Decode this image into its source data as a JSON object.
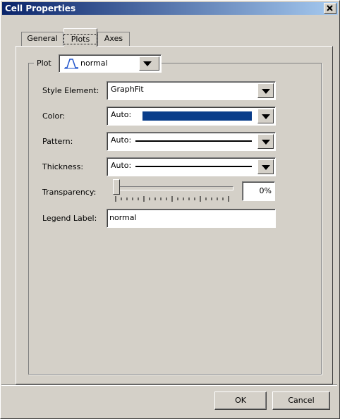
{
  "window": {
    "title": "Cell Properties",
    "close_glyph": "✕"
  },
  "tabs": [
    {
      "label": "General",
      "active": false
    },
    {
      "label": "Plots",
      "active": true
    },
    {
      "label": "Axes",
      "active": false
    }
  ],
  "plot": {
    "label": "Plot",
    "selected": "normal",
    "icon": "normal-curve-icon"
  },
  "fields": {
    "style_element": {
      "label": "Style Element:",
      "value": "GraphFit"
    },
    "color": {
      "label": "Color:",
      "value": "Auto:",
      "swatch": "#0a3d8a"
    },
    "pattern": {
      "label": "Pattern:",
      "value": "Auto:"
    },
    "thickness": {
      "label": "Thickness:",
      "value": "Auto:"
    },
    "transparency": {
      "label": "Transparency:",
      "value": "0%",
      "level": 0
    },
    "legend_label": {
      "label": "Legend Label:",
      "value": "normal"
    }
  },
  "buttons": {
    "ok": "OK",
    "cancel": "Cancel"
  }
}
